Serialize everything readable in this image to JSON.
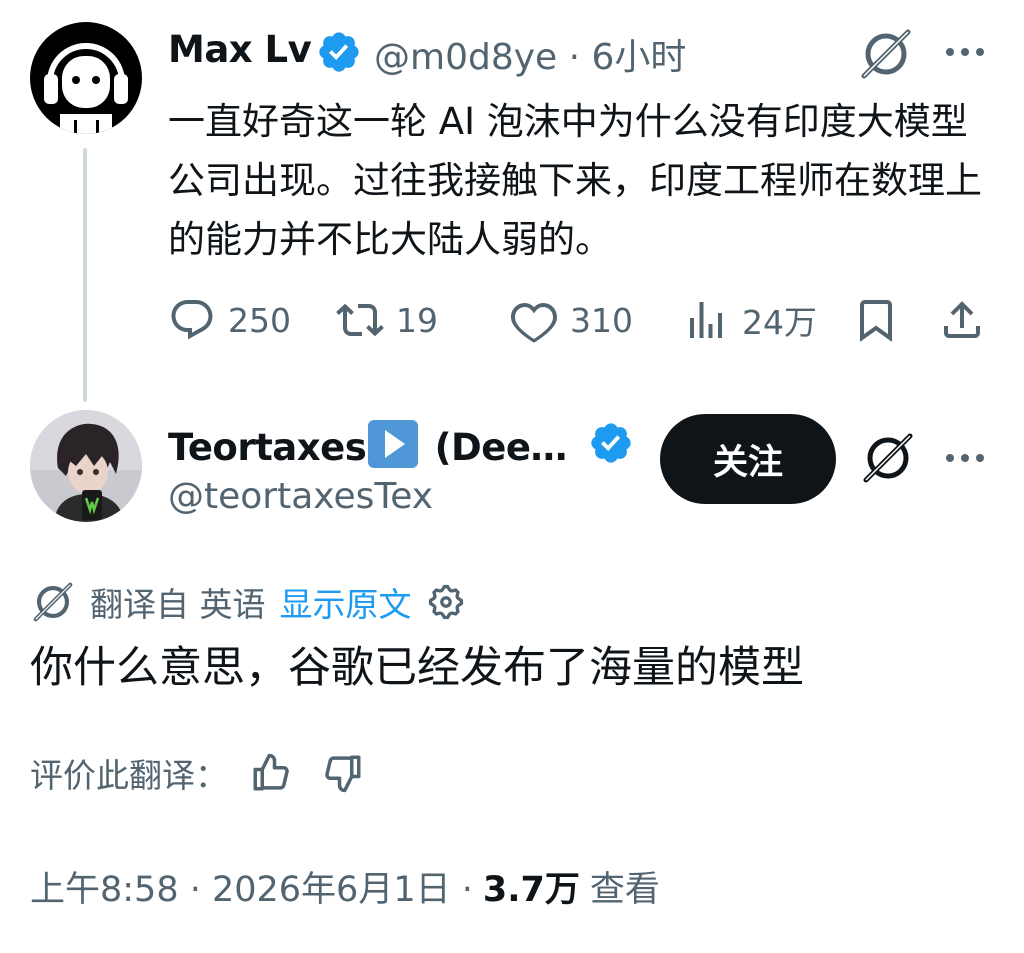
{
  "parent_tweet": {
    "author_name": "Max Lv",
    "handle": "@m0d8ye",
    "time": "6小时",
    "text": "一直好奇这一轮 AI 泡沫中为什么没有印度大模型公司出现。过往我接触下来，印度工程师在数理上的能力并不比大陆人弱的。",
    "stats": {
      "replies": "250",
      "retweets": "19",
      "likes": "310",
      "views": "24万"
    }
  },
  "reply_tweet": {
    "author_name": "Teortaxes",
    "author_name_suffix": "(Dee…",
    "handle": "@teortaxesTex",
    "follow_label": "关注",
    "translated_from": "翻译自 英语",
    "show_original": "显示原文",
    "text": "你什么意思，谷歌已经发布了海量的模型",
    "rate_translation": "评价此翻译：",
    "timestamp": "上午8:58 · 2026年6月1日 · ",
    "views_count": "3.7万",
    "views_label": "查看"
  },
  "colors": {
    "verified_blue": "#1d9bf0",
    "muted_text": "#536471",
    "primary_text": "#0f1419",
    "follow_button_bg": "#0f1419",
    "thread_line": "#cfd9de"
  },
  "icons": {
    "verified": "verified-badge-icon",
    "grok": "grok-icon",
    "more": "more-icon",
    "reply": "reply-icon",
    "retweet": "retweet-icon",
    "like": "heart-icon",
    "views": "views-icon",
    "bookmark": "bookmark-icon",
    "share": "share-icon",
    "settings": "gear-icon",
    "thumbs_up": "thumbs-up-icon",
    "thumbs_down": "thumbs-down-icon"
  }
}
